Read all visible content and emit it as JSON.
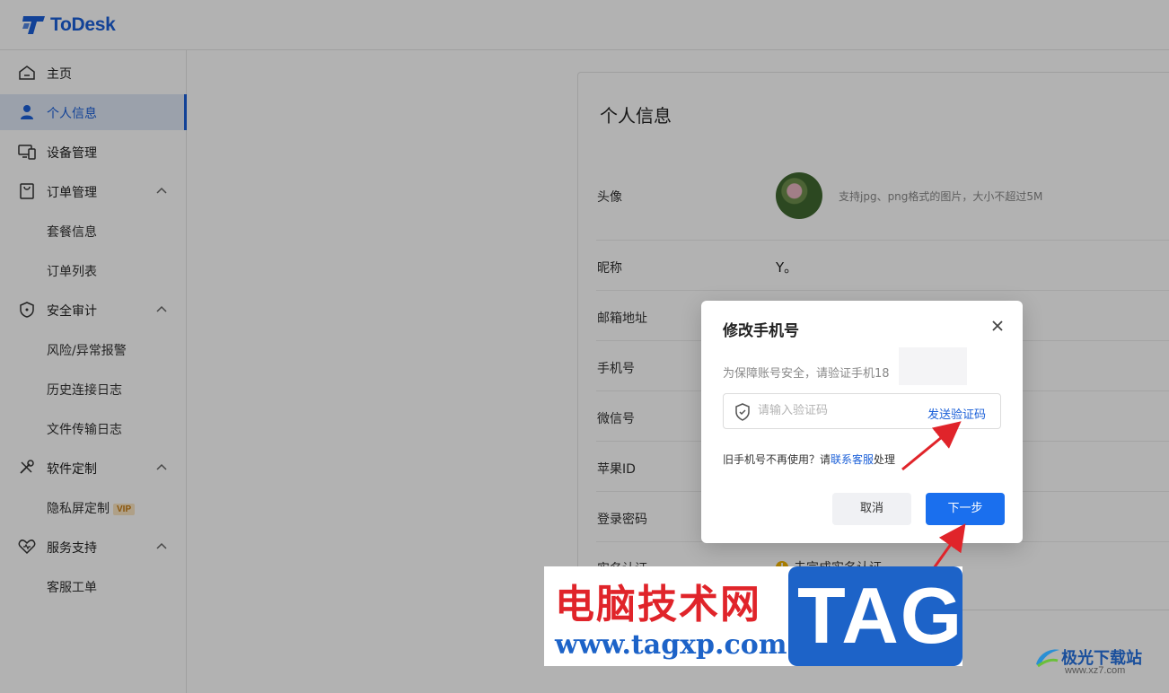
{
  "app": {
    "name": "ToDesk"
  },
  "sidebar": {
    "items": [
      {
        "label": "主页",
        "icon": "home-icon"
      },
      {
        "label": "个人信息",
        "icon": "user-icon",
        "active": true
      },
      {
        "label": "设备管理",
        "icon": "devices-icon"
      },
      {
        "label": "订单管理",
        "icon": "bag-icon",
        "expanded": true
      },
      {
        "label": "套餐信息"
      },
      {
        "label": "订单列表"
      },
      {
        "label": "安全审计",
        "icon": "shield-icon",
        "expanded": true
      },
      {
        "label": "风险/异常报警"
      },
      {
        "label": "历史连接日志"
      },
      {
        "label": "文件传输日志"
      },
      {
        "label": "软件定制",
        "icon": "tools-icon",
        "expanded": true
      },
      {
        "label": "隐私屏定制",
        "badge": "VIP"
      },
      {
        "label": "服务支持",
        "icon": "heart-icon",
        "expanded": true
      },
      {
        "label": "客服工单"
      }
    ]
  },
  "main": {
    "title": "个人信息",
    "avatar_label": "头像",
    "avatar_hint": "支持jpg、png格式的图片，大小不超过5M",
    "nickname_label": "昵称",
    "nickname_value": "Y。",
    "email_label": "邮箱地址",
    "phone_label": "手机号",
    "wechat_label": "微信号",
    "apple_label": "苹果ID",
    "password_label": "登录密码",
    "realname_label": "实名认证",
    "realname_status": "未完成实名认证"
  },
  "modal": {
    "title": "修改手机号",
    "description": "为保障账号安全，请验证手机18",
    "code_placeholder": "请输入验证码",
    "send_code": "发送验证码",
    "old_phone_prefix": "旧手机号不再使用？请",
    "old_phone_link": "联系客服",
    "old_phone_suffix": "处理",
    "cancel": "取消",
    "next": "下一步"
  },
  "watermark": {
    "cn_text": "电脑技术网",
    "url": "www.tagxp.com",
    "tag": "TAG",
    "corner_title": "极光下载站",
    "corner_url": "www.xz7.com"
  },
  "colors": {
    "accent": "#1a5fd8",
    "primary_button": "#1a6fee",
    "annotation_arrow": "#e0242a",
    "warning": "#f2b400"
  }
}
